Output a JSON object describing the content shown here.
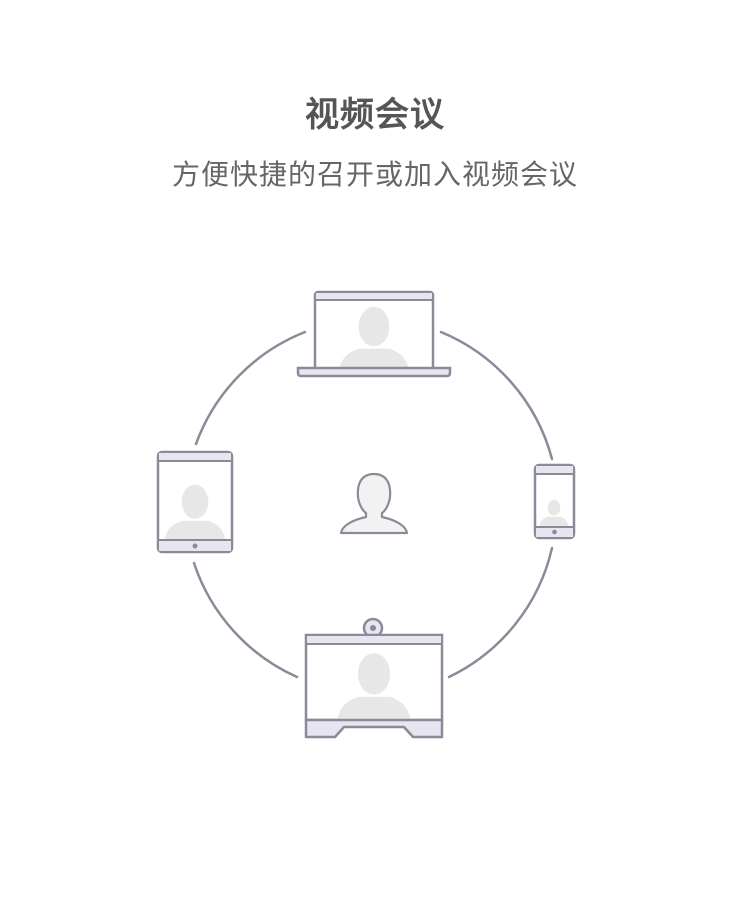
{
  "header": {
    "title": "视频会议",
    "subtitle": "方便快捷的召开或加入视频会议"
  },
  "illustration": {
    "devices": [
      "laptop-icon",
      "tablet-icon",
      "phone-icon",
      "room-system-icon"
    ],
    "center": "user-icon",
    "colors": {
      "outline": "#8c8a98",
      "fill": "#e6e5f0",
      "screen": "#ffffff",
      "silhouette": "#e7e7e7"
    }
  }
}
